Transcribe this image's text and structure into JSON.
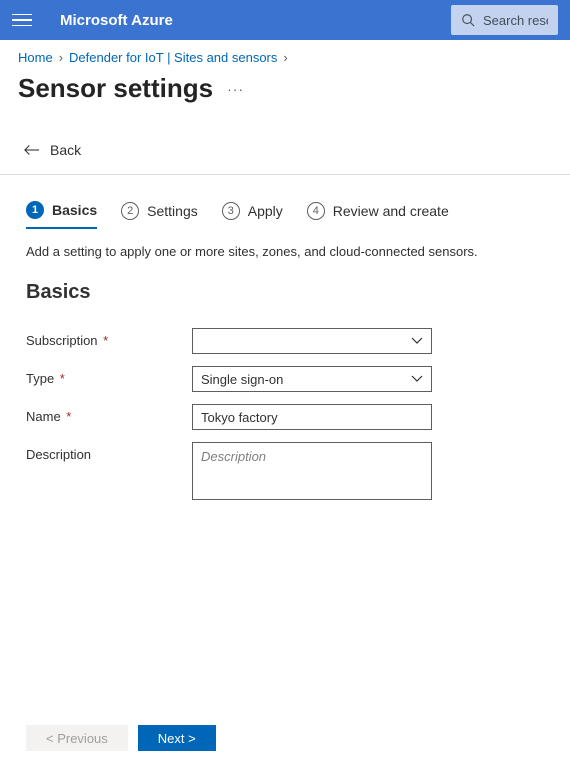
{
  "header": {
    "brand": "Microsoft Azure",
    "search_placeholder": "Search resou"
  },
  "breadcrumb": {
    "items": [
      "Home",
      "Defender for IoT | Sites and sensors"
    ]
  },
  "page": {
    "title": "Sensor settings",
    "back_label": "Back"
  },
  "steps": [
    {
      "num": "1",
      "label": "Basics"
    },
    {
      "num": "2",
      "label": "Settings"
    },
    {
      "num": "3",
      "label": "Apply"
    },
    {
      "num": "4",
      "label": "Review and create"
    }
  ],
  "helper_text": "Add a setting to apply one or more sites, zones, and cloud-connected sensors.",
  "section_heading": "Basics",
  "form": {
    "subscription": {
      "label": "Subscription",
      "value": ""
    },
    "type": {
      "label": "Type",
      "value": "Single sign-on"
    },
    "name": {
      "label": "Name",
      "value": "Tokyo factory"
    },
    "description": {
      "label": "Description",
      "placeholder": "Description",
      "value": ""
    }
  },
  "footer": {
    "previous": "< Previous",
    "next": "Next >"
  }
}
